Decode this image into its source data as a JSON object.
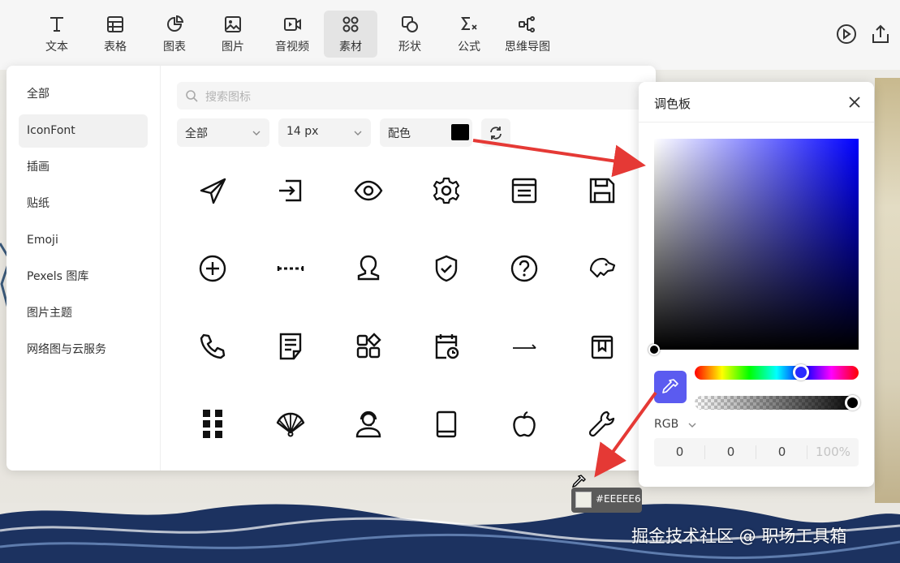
{
  "toolbar": {
    "items": [
      {
        "label": "文本",
        "icon": "text-icon"
      },
      {
        "label": "表格",
        "icon": "table-icon"
      },
      {
        "label": "图表",
        "icon": "pie-chart-icon"
      },
      {
        "label": "图片",
        "icon": "image-icon"
      },
      {
        "label": "音视频",
        "icon": "video-icon"
      },
      {
        "label": "素材",
        "icon": "grid-icon",
        "active": true
      },
      {
        "label": "形状",
        "icon": "shape-icon"
      },
      {
        "label": "公式",
        "icon": "sigma-icon"
      },
      {
        "label": "思维导图",
        "icon": "mindmap-icon"
      }
    ],
    "right_icons": [
      "play-icon",
      "share-icon"
    ]
  },
  "sidebar": {
    "items": [
      {
        "label": "全部"
      },
      {
        "label": "IconFont",
        "active": true
      },
      {
        "label": "插画"
      },
      {
        "label": "贴纸"
      },
      {
        "label": "Emoji"
      },
      {
        "label": "Pexels 图库"
      },
      {
        "label": "图片主题"
      },
      {
        "label": "网络图与云服务"
      }
    ]
  },
  "filters": {
    "search_placeholder": "搜索图标",
    "category": "全部",
    "size": "14  px",
    "color_label": "配色",
    "color_value": "#000000"
  },
  "icons": [
    "send-icon",
    "login-icon",
    "eye-icon",
    "gear-icon",
    "window-icon",
    "save-icon",
    "plus-circle-icon",
    "dashed-line-icon",
    "user-icon",
    "shield-check-icon",
    "question-circle-icon",
    "dog-icon",
    "phone-icon",
    "note-icon",
    "apps-icon",
    "calendar-clock-icon",
    "long-arrow-icon",
    "bookmark-book-icon",
    "dots-grid-icon",
    "fan-icon",
    "headset-user-icon",
    "tablet-icon",
    "apple-icon",
    "wrench-icon"
  ],
  "palette": {
    "title": "调色板",
    "mode": "RGB",
    "values": [
      "0",
      "0",
      "0",
      "100%"
    ],
    "hue_color": "#0000ff",
    "current_color": "#000000"
  },
  "tooltip": {
    "color_hex": "#EEEEE6"
  },
  "watermark": "掘金技术社区 @ 职场工具箱",
  "colors": {
    "accent": "#5b5bf0",
    "arrow": "#e53935"
  }
}
